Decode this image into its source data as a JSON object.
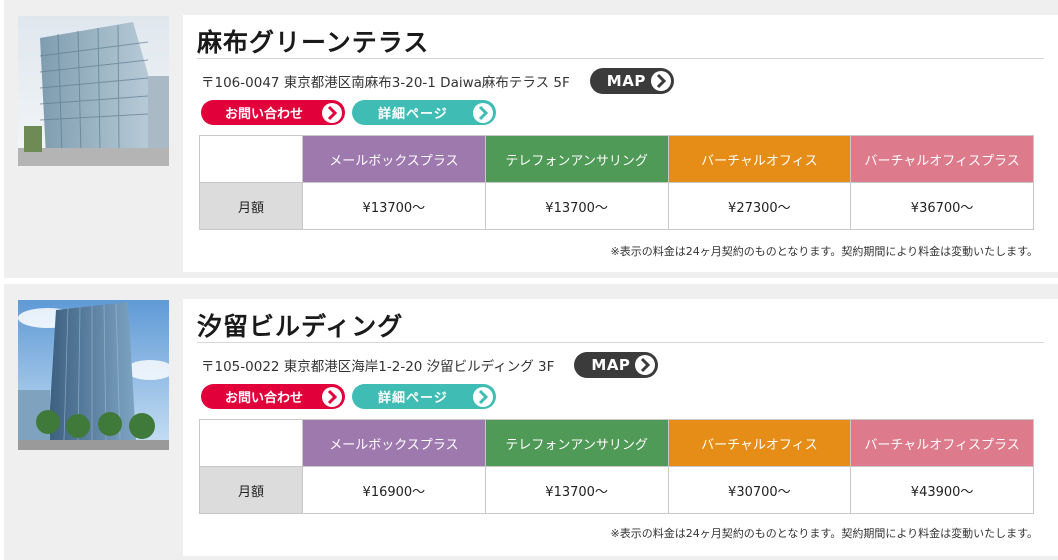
{
  "colors": {
    "mailbox": "#9d79ae",
    "telephone": "#4f9a56",
    "virtual": "#e58d17",
    "virtual_plus": "#dd7a8b",
    "contact_button": "#e2003a",
    "detail_button": "#3fbdb5",
    "map_button": "#3b3b3b"
  },
  "plans": [
    "メールボックスプラス",
    "テレフォンアンサリング",
    "バーチャルオフィス",
    "バーチャルオフィスプラス"
  ],
  "row_label": "月額",
  "map_label": "MAP",
  "contact_label": "お問い合わせ",
  "detail_label": "詳細ページ",
  "note": "※表示の料金は24ヶ月契約のものとなります。契約期間により料金は変動いたします。",
  "listings": [
    {
      "name": "麻布グリーンテラス",
      "address": "〒106-0047 東京都港区南麻布3-20-1 Daiwa麻布テラス 5F",
      "prices": [
        "¥13700～",
        "¥13700～",
        "¥27300～",
        "¥36700～"
      ]
    },
    {
      "name": "汐留ビルディング",
      "address": "〒105-0022 東京都港区海岸1-2-20 汐留ビルディング 3F",
      "prices": [
        "¥16900～",
        "¥13700～",
        "¥30700～",
        "¥43900～"
      ]
    }
  ]
}
